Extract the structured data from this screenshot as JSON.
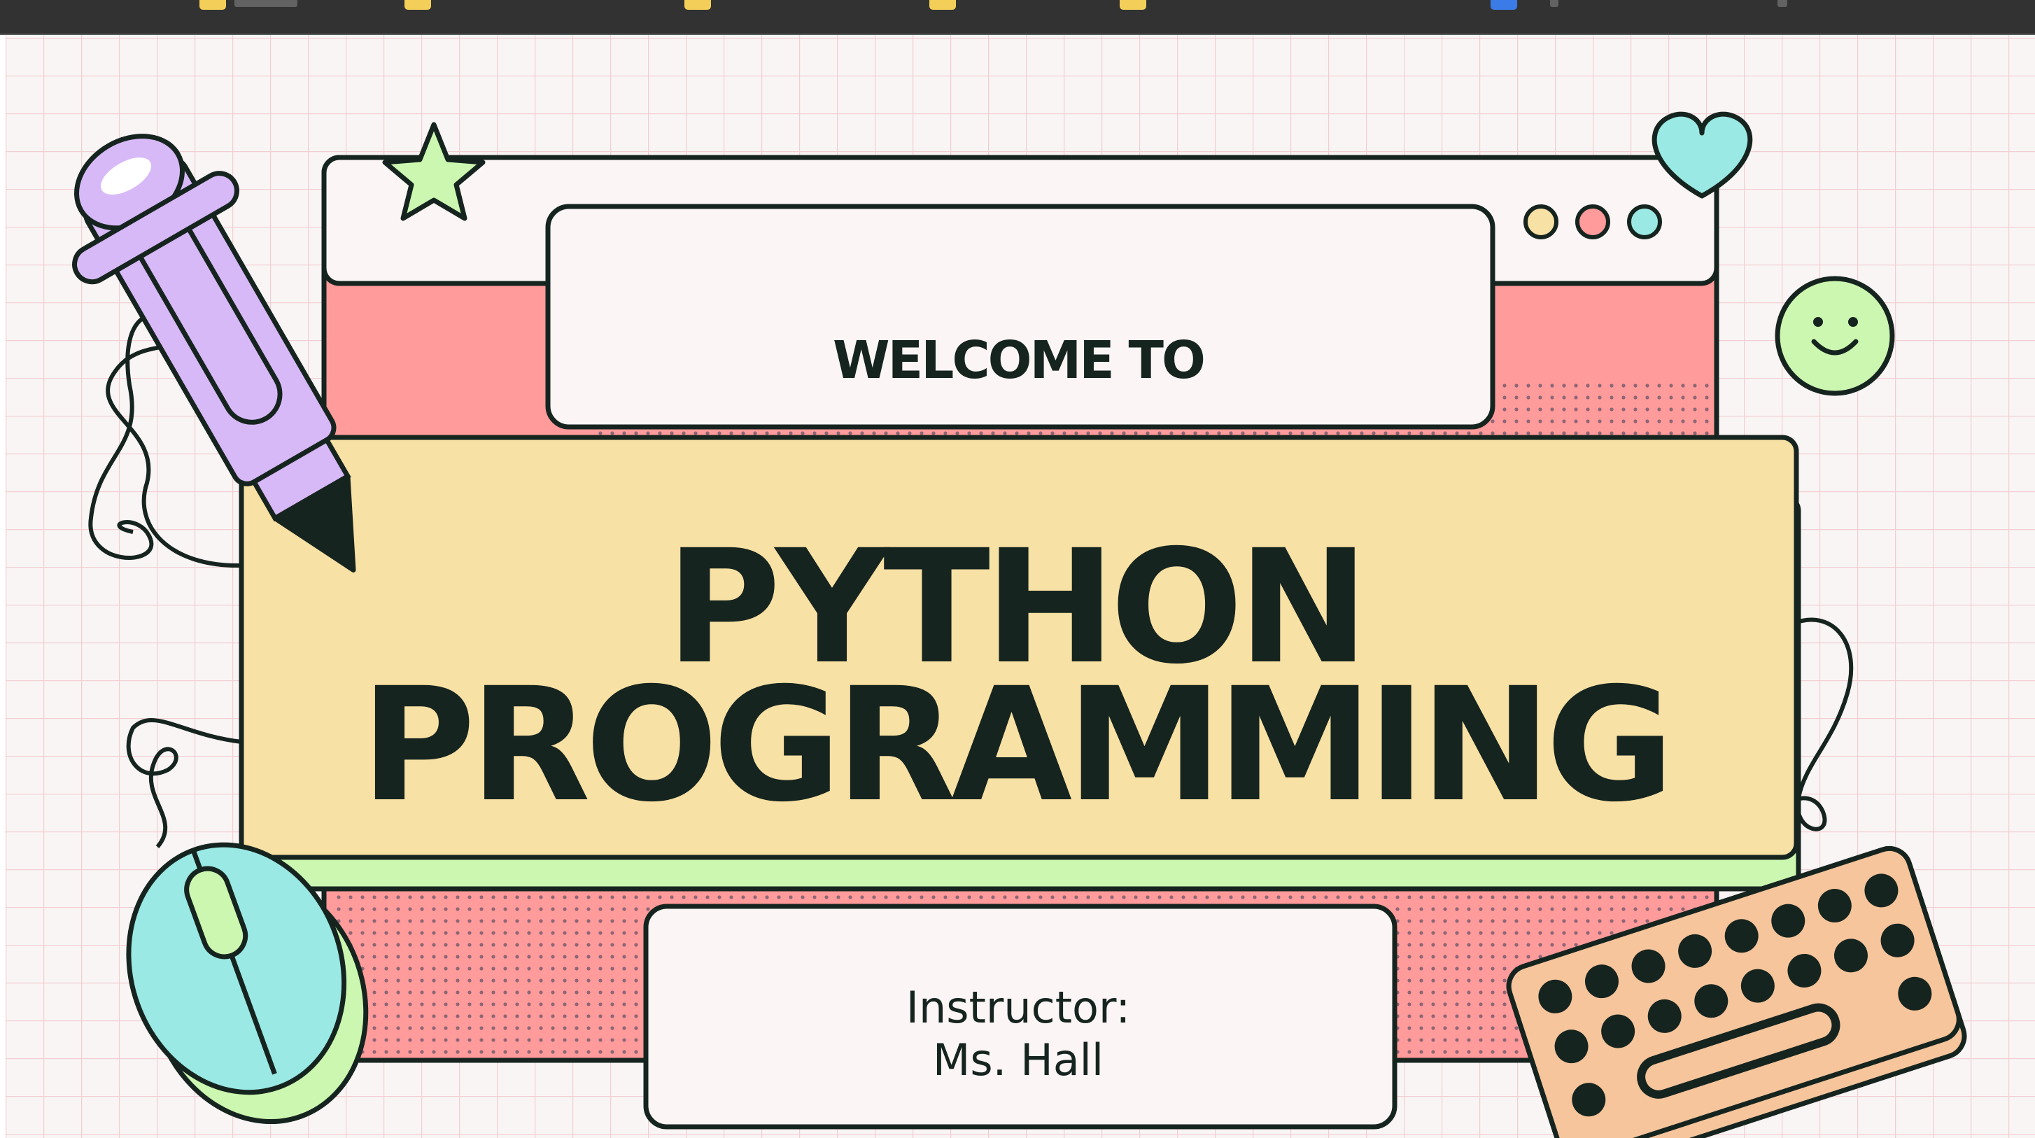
{
  "browser": {
    "bookmarks": [
      {
        "icon": "folder-icon",
        "color": "#f3cf5a"
      },
      {
        "icon": "folder-icon",
        "color": "#f3cf5a"
      },
      {
        "icon": "folder-icon",
        "color": "#f3cf5a"
      },
      {
        "icon": "folder-icon",
        "color": "#f3cf5a"
      },
      {
        "icon": "folder-icon",
        "color": "#f3cf5a"
      },
      {
        "icon": "doc-icon",
        "color": "#3b7be8"
      }
    ]
  },
  "slide": {
    "welcome": "WELCOME TO",
    "title_line1": "PYTHON",
    "title_line2": "PROGRAMMING",
    "instructor_label": "Instructor:",
    "instructor_name": "Ms. Hall"
  },
  "colors": {
    "background": "#faf5f5",
    "grid_line": "#f0cfd3",
    "outline": "#16241f",
    "pink": "#ff9b9b",
    "yellow": "#f8e1a4",
    "green": "#ccf7b1",
    "lavender": "#d8b9f7",
    "teal": "#9ae9e4",
    "peach": "#f6c59c"
  }
}
